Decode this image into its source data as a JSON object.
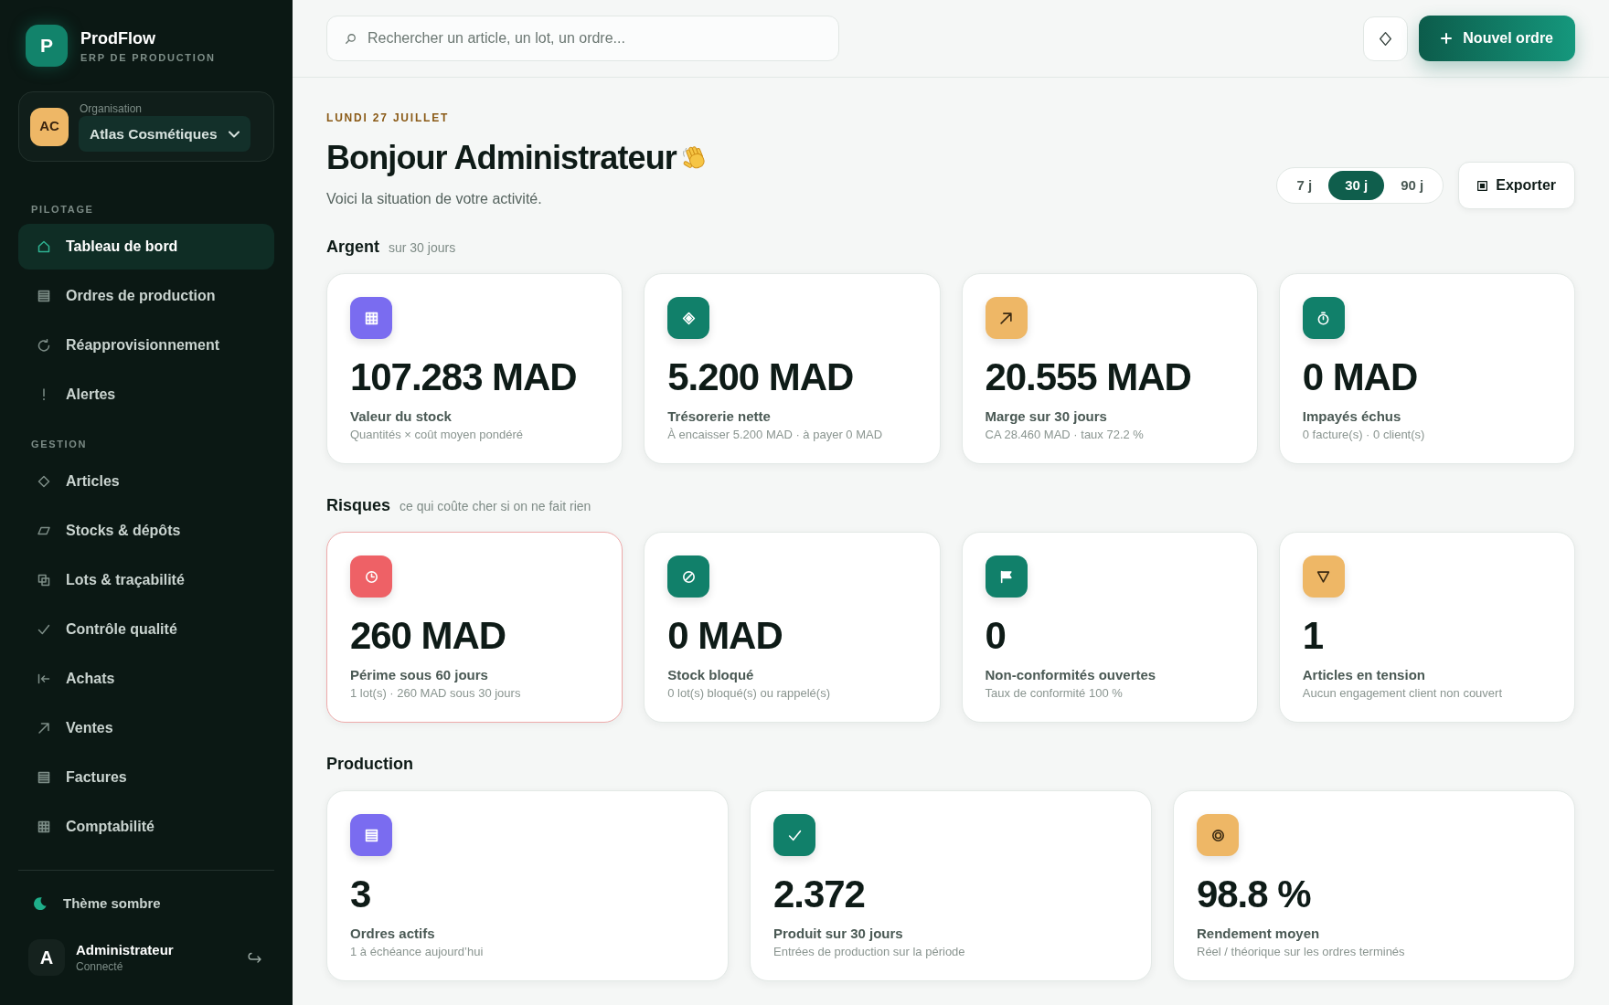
{
  "sidebar": {
    "brand": {
      "logo": "P",
      "name": "ProdFlow",
      "tagline": "ERP DE PRODUCTION"
    },
    "organization": {
      "initials": "AC",
      "label": "Organisation",
      "value": "Atlas Cosmétiques"
    },
    "sections": [
      {
        "title": "PILOTAGE",
        "items": [
          {
            "label": "Tableau de bord",
            "selected": true
          },
          {
            "label": "Ordres de production",
            "selected": false
          },
          {
            "label": "Réapprovisionnement",
            "selected": false
          },
          {
            "label": "Alertes",
            "selected": false
          }
        ]
      },
      {
        "title": "GESTION",
        "items": [
          {
            "label": "Articles",
            "selected": false
          },
          {
            "label": "Stocks & dépôts",
            "selected": false
          },
          {
            "label": "Lots & traçabilité",
            "selected": false
          },
          {
            "label": "Contrôle qualité",
            "selected": false
          },
          {
            "label": "Achats",
            "selected": false
          },
          {
            "label": "Ventes",
            "selected": false
          },
          {
            "label": "Factures",
            "selected": false
          },
          {
            "label": "Comptabilité",
            "selected": false
          }
        ]
      }
    ],
    "theme_toggle": "Thème sombre",
    "user": {
      "initial": "A",
      "name": "Administrateur",
      "status": "Connecté"
    }
  },
  "topbar": {
    "search": {
      "placeholder": "Rechercher un article, un lot, un ordre..."
    },
    "new_button": "Nouvel ordre"
  },
  "header": {
    "date": "LUNDI 27 JUILLET",
    "title": "Bonjour Administrateur",
    "subtitle": "Voici la situation de votre activité.",
    "periods": [
      {
        "label": "7 j",
        "selected": false
      },
      {
        "label": "30 j",
        "selected": true
      },
      {
        "label": "90 j",
        "selected": false
      }
    ],
    "export_button": "Exporter"
  },
  "dashboard": {
    "sections": [
      {
        "title": "Argent",
        "note": "sur 30 jours",
        "cards": [
          {
            "color": "#7a6cf0",
            "value": "107.283 MAD",
            "label": "Valeur du stock",
            "detail": "Quantités × coût moyen pondéré",
            "alert": false
          },
          {
            "color": "#11806a",
            "value": "5.200 MAD",
            "label": "Trésorerie nette",
            "detail": "À encaisser 5.200 MAD · à payer 0 MAD",
            "alert": false
          },
          {
            "color": "#eeb766",
            "value": "20.555 MAD",
            "label": "Marge sur 30 jours",
            "detail": "CA 28.460 MAD · taux 72.2 %",
            "alert": false
          },
          {
            "color": "#11806a",
            "value": "0 MAD",
            "label": "Impayés échus",
            "detail": "0 facture(s) · 0 client(s)",
            "alert": false
          }
        ]
      },
      {
        "title": "Risques",
        "note": "ce qui coûte cher si on ne fait rien",
        "cards": [
          {
            "color": "#ee6166",
            "value": "260 MAD",
            "label": "Périme sous 60 jours",
            "detail": "1 lot(s) · 260 MAD sous 30 jours",
            "alert": true
          },
          {
            "color": "#11806a",
            "value": "0 MAD",
            "label": "Stock bloqué",
            "detail": "0 lot(s) bloqué(s) ou rappelé(s)",
            "alert": false
          },
          {
            "color": "#11806a",
            "value": "0",
            "label": "Non-conformités ouvertes",
            "detail": "Taux de conformité 100 %",
            "alert": false
          },
          {
            "color": "#eeb766",
            "value": "1",
            "label": "Articles en tension",
            "detail": "Aucun engagement client non couvert",
            "alert": false
          }
        ]
      },
      {
        "title": "Production",
        "cards": [
          {
            "color": "#7a6cf0",
            "value": "3",
            "label": "Ordres actifs",
            "detail": "1 à échéance aujourd’hui",
            "alert": false
          },
          {
            "color": "#11806a",
            "value": "2.372",
            "label": "Produit sur 30 jours",
            "detail": "Entrées de production sur la période",
            "alert": false
          },
          {
            "color": "#eeb766",
            "value": "98.8 %",
            "label": "Rendement moyen",
            "detail": "Réel / théorique sur les ordres terminés",
            "alert": false
          }
        ]
      }
    ]
  }
}
